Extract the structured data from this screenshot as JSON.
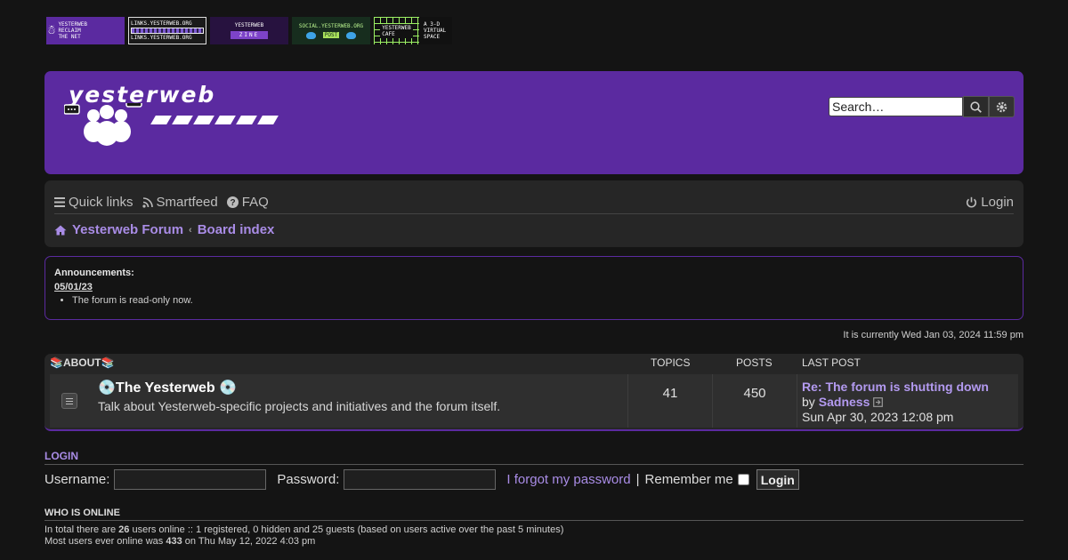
{
  "banners": [
    {
      "name": "reclaim-the-net-banner",
      "line1": "YESTERWEB",
      "line2": "RECLAIM",
      "line3": "THE NET"
    },
    {
      "name": "links-banner",
      "line1": "LINKS.YESTERWEB.ORG",
      "line2": "LINKS.YESTERWEB.ORG"
    },
    {
      "name": "zine-banner",
      "line1": "YESTERWEB",
      "line2": "ZINE"
    },
    {
      "name": "social-banner",
      "line1": "SOCIAL.YESTERWEB.ORG",
      "line2": "POST"
    },
    {
      "name": "cafe-banner",
      "line1": "YESTERWEB",
      "line2": "CAFE",
      "line3": "A 3-D",
      "line4": "VIRTUAL",
      "line5": "SPACE"
    }
  ],
  "header": {
    "logo_text": "yesterweb",
    "search_placeholder": "Search…",
    "bg_color": "#5b2aa0"
  },
  "nav": {
    "quick_links": "Quick links",
    "smartfeed": "Smartfeed",
    "faq": "FAQ",
    "login": "Login",
    "breadcrumb_home": "Yesterweb Forum",
    "breadcrumb_index": "Board index"
  },
  "announcement": {
    "heading": "Announcements:",
    "date": "05/01/23",
    "items": [
      "The forum is read-only now."
    ]
  },
  "clock": "It is currently Wed Jan 03, 2024 11:59 pm",
  "forum": {
    "category": "📚ABOUT📚",
    "col_topics": "TOPICS",
    "col_posts": "POSTS",
    "col_last": "LAST POST",
    "rows": [
      {
        "title": "💿The Yesterweb 💿",
        "description": "Talk about Yesterweb-specific projects and initiatives and the forum itself.",
        "topics": "41",
        "posts": "450",
        "last_title": "Re: The forum is shutting down",
        "last_by_prefix": "by",
        "last_author": "Sadness",
        "last_date": "Sun Apr 30, 2023 12:08 pm"
      }
    ]
  },
  "login": {
    "title": "LOGIN",
    "username_label": "Username:",
    "password_label": "Password:",
    "forgot": "I forgot my password",
    "separator": "|",
    "remember": "Remember me",
    "button": "Login"
  },
  "online": {
    "title": "WHO IS ONLINE",
    "line1_a": "In total there are ",
    "line1_count": "26",
    "line1_b": " users online :: 1 registered, 0 hidden and 25 guests (based on users active over the past 5 minutes)",
    "line2_a": "Most users ever online was ",
    "line2_count": "433",
    "line2_b": " on Thu May 12, 2022 4:03 pm"
  }
}
